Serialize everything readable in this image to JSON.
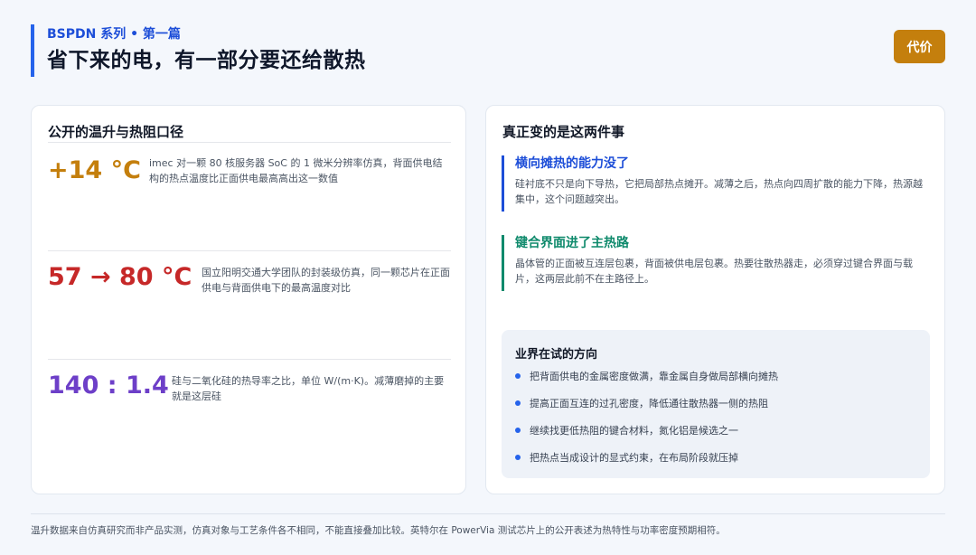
{
  "header": {
    "series": "BSPDN 系列 • 第一篇",
    "title": "省下来的电，有一部分要还给散热",
    "badge": "代价"
  },
  "left_card": {
    "title": "公开的温升与热阻口径",
    "metrics": [
      {
        "value": "+14 °C",
        "color": "#c47f0d",
        "desc": "imec 对一颗 80 核服务器 SoC 的 1 微米分辨率仿真，背面供电结构的热点温度比正面供电最高高出这一数值"
      },
      {
        "value": "57 → 80 °C",
        "color": "#c62828",
        "desc": "国立阳明交通大学团队的封装级仿真，同一颗芯片在正面供电与背面供电下的最高温度对比"
      },
      {
        "value": "140 : 1.4",
        "color": "#6d3fc8",
        "desc": "硅与二氧化硅的热导率之比，单位 W/(m·K)。减薄磨掉的主要就是这层硅"
      }
    ]
  },
  "right_card": {
    "title": "真正变的是这两件事",
    "points": [
      {
        "title": "横向摊热的能力没了",
        "color": "#1d4ed8",
        "desc": "硅衬底不只是向下导热，它把局部热点摊开。减薄之后，热点向四周扩散的能力下降，热源越集中，这个问题越突出。"
      },
      {
        "title": "键合界面进了主热路",
        "color": "#0f8a6c",
        "desc": "晶体管的正面被互连层包裹，背面被供电层包裹。热要往散热器走，必须穿过键合界面与载片，这两层此前不在主路径上。"
      }
    ],
    "direction": {
      "title": "业界在试的方向",
      "items": [
        "把背面供电的金属密度做满，靠金属自身做局部横向摊热",
        "提高正面互连的过孔密度，降低通往散热器一侧的热阻",
        "继续找更低热阻的键合材料，氮化铝是候选之一",
        "把热点当成设计的显式约束，在布局阶段就压掉"
      ]
    }
  },
  "footer": "温升数据来自仿真研究而非产品实测，仿真对象与工艺条件各不相同，不能直接叠加比较。英特尔在 PowerVia 测试芯片上的公开表述为热特性与功率密度预期相符。"
}
